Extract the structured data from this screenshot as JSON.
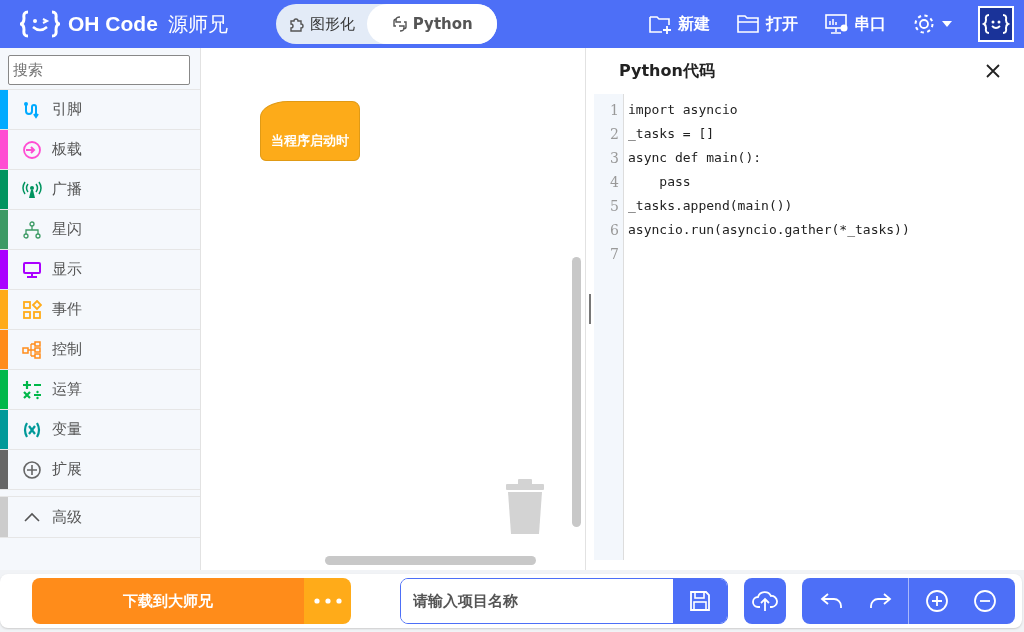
{
  "header": {
    "logo_text": "OH Code",
    "logo_subtitle": "源师兄",
    "mode_tabs": [
      {
        "label": "图形化",
        "selected": false
      },
      {
        "label": "Python",
        "selected": true
      }
    ],
    "actions": [
      {
        "label": "新建"
      },
      {
        "label": "打开"
      },
      {
        "label": "串口"
      }
    ]
  },
  "sidebar": {
    "search": {
      "placeholder": "搜索"
    },
    "categories": [
      {
        "label": "引脚",
        "color": "#00aaff"
      },
      {
        "label": "板载",
        "color": "#ff4dd2"
      },
      {
        "label": "广播",
        "color": "#00945f"
      },
      {
        "label": "星闪",
        "color": "#3c9a64"
      },
      {
        "label": "显示",
        "color": "#aa00ff"
      },
      {
        "label": "事件",
        "color": "#ffab19"
      },
      {
        "label": "控制",
        "color": "#ff8c1a"
      },
      {
        "label": "运算",
        "color": "#00b84a"
      },
      {
        "label": "变量",
        "color": "#009999"
      },
      {
        "label": "扩展",
        "color": "#666666"
      }
    ],
    "advanced": {
      "label": "高级",
      "color": "#cccccc",
      "expanded": false
    }
  },
  "canvas": {
    "blocks": [
      {
        "label": "当程序启动时"
      }
    ]
  },
  "code_panel": {
    "title": "Python代码",
    "lines": [
      {
        "number": "1",
        "code": "import asyncio"
      },
      {
        "number": "2",
        "code": "_tasks = []"
      },
      {
        "number": "3",
        "code": "async def main():"
      },
      {
        "number": "4",
        "code": "    pass"
      },
      {
        "number": "5",
        "code": "_tasks.append(main())"
      },
      {
        "number": "6",
        "code": "asyncio.run(asyncio.gather(*_tasks))"
      },
      {
        "number": "7"
      }
    ]
  },
  "bottom_bar": {
    "download_button": "下载到大师兄",
    "project_name": {
      "placeholder": "请输入项目名称"
    }
  }
}
